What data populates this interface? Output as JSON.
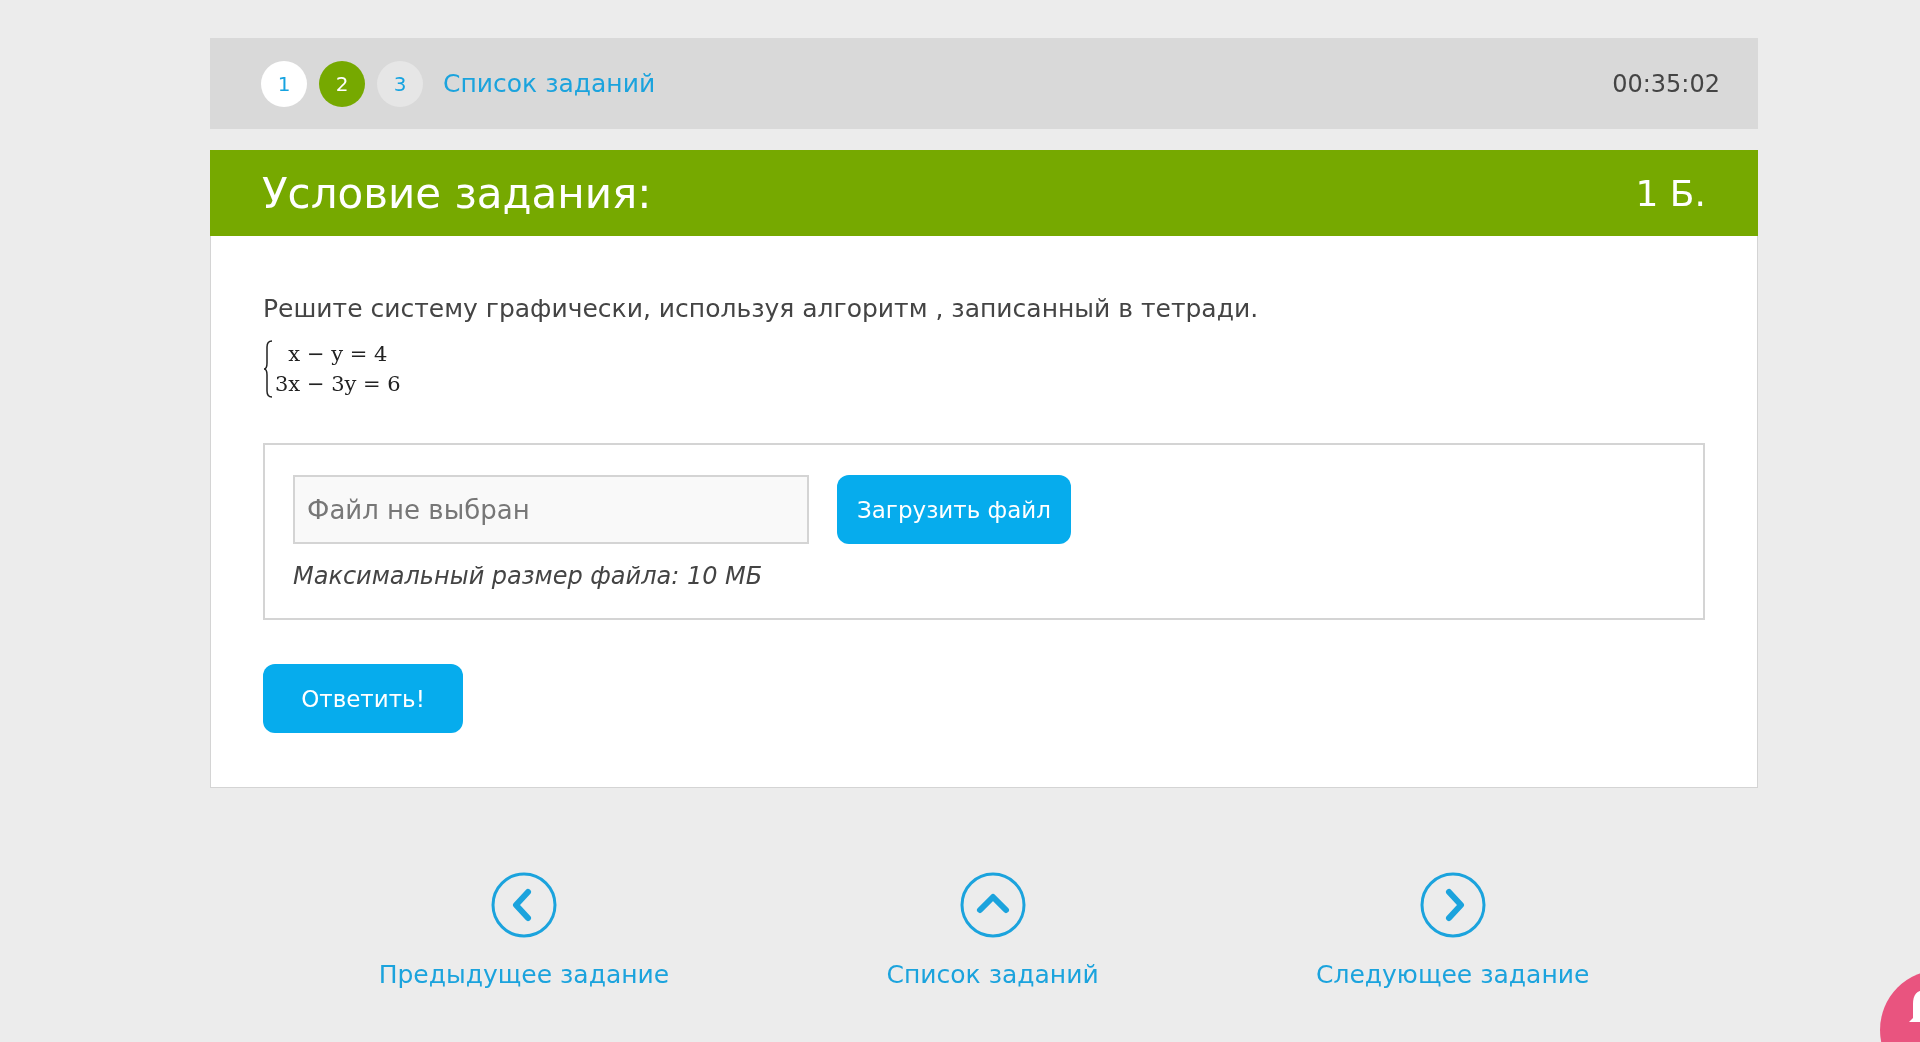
{
  "top_bar": {
    "steps": [
      {
        "label": "1",
        "selected": false,
        "kind": "visited"
      },
      {
        "label": "2",
        "selected": true,
        "kind": "visited"
      },
      {
        "label": "3",
        "selected": false,
        "kind": "unvisited"
      }
    ],
    "task_list_link": "Список заданий",
    "timer": "00:35:02"
  },
  "task": {
    "title": "Условие задания:",
    "points": "1 Б.",
    "statement": "Решите систему графически, используя алгоритм , записанный в тетради.",
    "equations": [
      "x − y = 4",
      "3x − 3y = 6"
    ]
  },
  "upload": {
    "placeholder": "Файл не выбран",
    "button": "Загрузить файл",
    "note": "Максимальный размер файла: 10 МБ"
  },
  "answer_button": "Ответить!",
  "bottom_nav": [
    {
      "kind": "prev",
      "label": "Предыдущее задание"
    },
    {
      "kind": "up",
      "label": "Список заданий"
    },
    {
      "kind": "next",
      "label": "Следующее задание"
    }
  ]
}
